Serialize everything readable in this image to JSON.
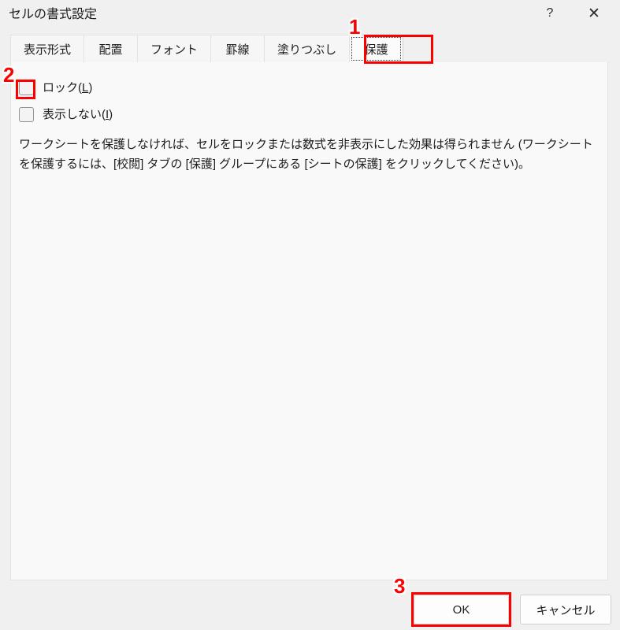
{
  "window": {
    "title": "セルの書式設定",
    "help_icon": "question-mark-icon",
    "help_label": "?",
    "close_icon": "close-icon",
    "close_label": "✕"
  },
  "tabs": [
    {
      "label": "表示形式",
      "selected": false
    },
    {
      "label": "配置",
      "selected": false
    },
    {
      "label": "フォント",
      "selected": false
    },
    {
      "label": "罫線",
      "selected": false
    },
    {
      "label": "塗りつぶし",
      "selected": false
    },
    {
      "label": "保護",
      "selected": true
    }
  ],
  "protection": {
    "lock_checkbox": {
      "label_main": "ロック(",
      "label_accel": "L",
      "label_close": ")",
      "checked": false
    },
    "hidden_checkbox": {
      "label_main": "表示しない(",
      "label_accel": "I",
      "label_close": ")",
      "checked": false
    },
    "description": "ワークシートを保護しなければ、セルをロックまたは数式を非表示にした効果は得られません (ワークシートを保護するには、[校閲] タブの [保護] グループにある [シートの保護] をクリックしてください)。"
  },
  "footer": {
    "ok_label": "OK",
    "cancel_label": "キャンセル"
  },
  "annotations": {
    "accent_color": "#fc0000",
    "markers": [
      {
        "number": "1",
        "target": "protection-tab"
      },
      {
        "number": "2",
        "target": "lock-checkbox"
      },
      {
        "number": "3",
        "target": "ok-button"
      }
    ]
  }
}
